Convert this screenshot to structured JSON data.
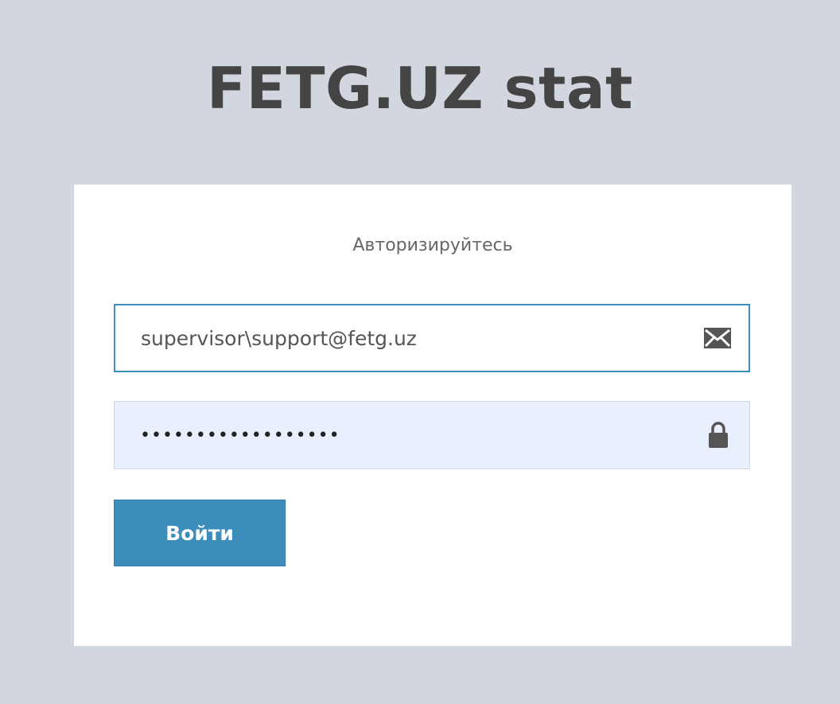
{
  "app": {
    "logo_text": "FETG.UZ stat"
  },
  "login_box": {
    "message": "Авторизируйтесь",
    "email_field": {
      "value": "supervisor\\support@fetg.uz",
      "icon": "envelope-icon"
    },
    "password_field": {
      "value": "••••••••••••••••••",
      "icon": "lock-icon"
    },
    "submit_label": "Войти"
  },
  "colors": {
    "page_background": "#d2d6de",
    "box_background": "#ffffff",
    "accent": "#3c8dbc",
    "autofill_background": "#e8f0fe",
    "logo_text": "#444444"
  }
}
